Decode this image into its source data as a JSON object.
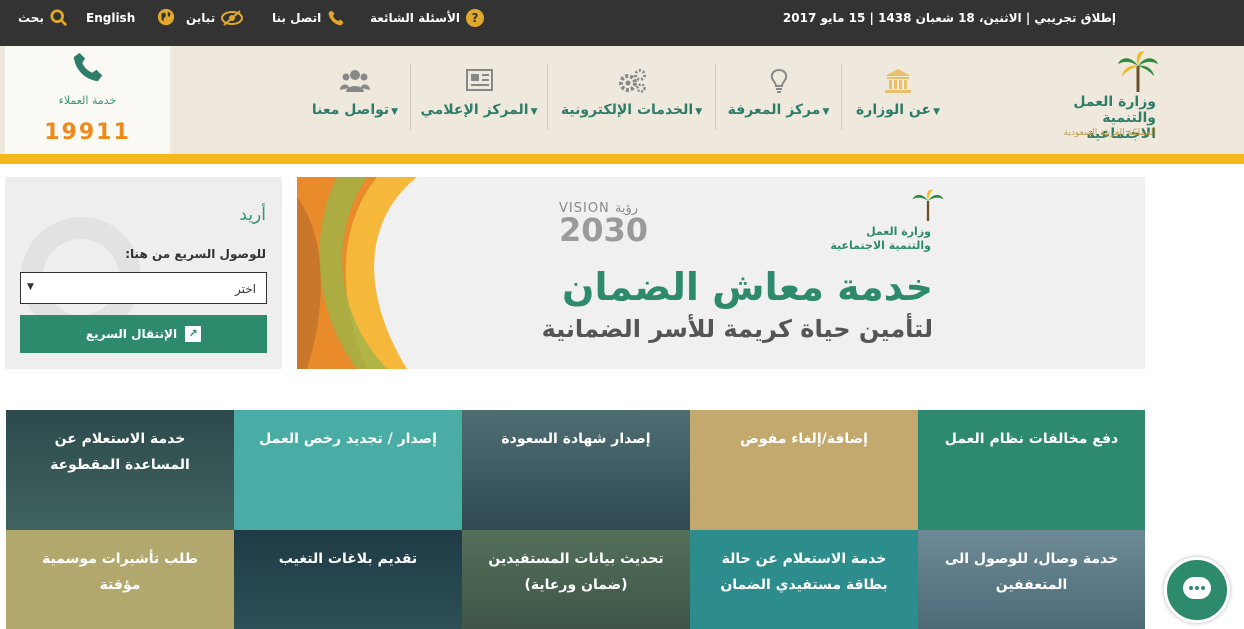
{
  "topbar": {
    "date_text": "إطلاق تجريبي | الاثنين، 18 شعبان 1438 | 15 مايو 2017",
    "faq": "الأسئلة الشائعة",
    "contact": "اتصل بنا",
    "contrast": "تباين",
    "english": "English",
    "search": "بحث"
  },
  "callbox": {
    "label": "خدمة العملاء",
    "number": "19911"
  },
  "nav": {
    "about": "عن الوزارة",
    "knowledge": "مركز المعرفة",
    "eservices": "الخدمات الإلكترونية",
    "media": "المركز الإعلامي",
    "connect": "تواصل معنا"
  },
  "logo": {
    "line1": "وزارة العمل",
    "line2": "والتنمية الاجتماعية",
    "line3": "المملكة العربية السعودية"
  },
  "quick": {
    "title": "أريد",
    "subtitle": "للوصول السريع من هنا:",
    "select_value": "اختر",
    "go_label": "الإنتقال السريع"
  },
  "banner": {
    "vision_word": "VISION رؤية",
    "vision_year": "2030",
    "logo_line1": "وزارة العمل",
    "logo_line2": "والتنمية الاجتماعية",
    "headline": "خدمة معاش الضمان",
    "subline": "لتأمين حياة كريمة للأسر الضمانية"
  },
  "tiles": {
    "t1": "دفع مخالفات نظام العمل",
    "t2": "إضافة/إلغاء مفوض",
    "t3": "إصدار شهادة السعودة",
    "t4": "إصدار / تجديد رخص العمل",
    "t5": "خدمة الاستعلام عن المساعدة المقطوعة",
    "t6": "خدمة وصال، للوصول الى المتعففين",
    "t7": "خدمة الاستعلام عن حالة بطاقة مستفيدي الضمان",
    "t8": "تحديث بيانات المستفيدين (ضمان ورعاية)",
    "t9": "تقديم بلاغات التغيب",
    "t10": "طلب تأشيرات موسمية مؤقتة"
  },
  "colors": {
    "green": "#2d8a6c",
    "gold": "#f4b81c",
    "orange": "#ef8a1a",
    "topbar": "#333333"
  },
  "icons": [
    "help-icon",
    "phone-icon",
    "contrast-icon",
    "globe-icon",
    "search-icon",
    "building-icon",
    "lightbulb-icon",
    "gears-icon",
    "newspaper-icon",
    "users-icon",
    "chat-icon",
    "external-link-icon"
  ]
}
